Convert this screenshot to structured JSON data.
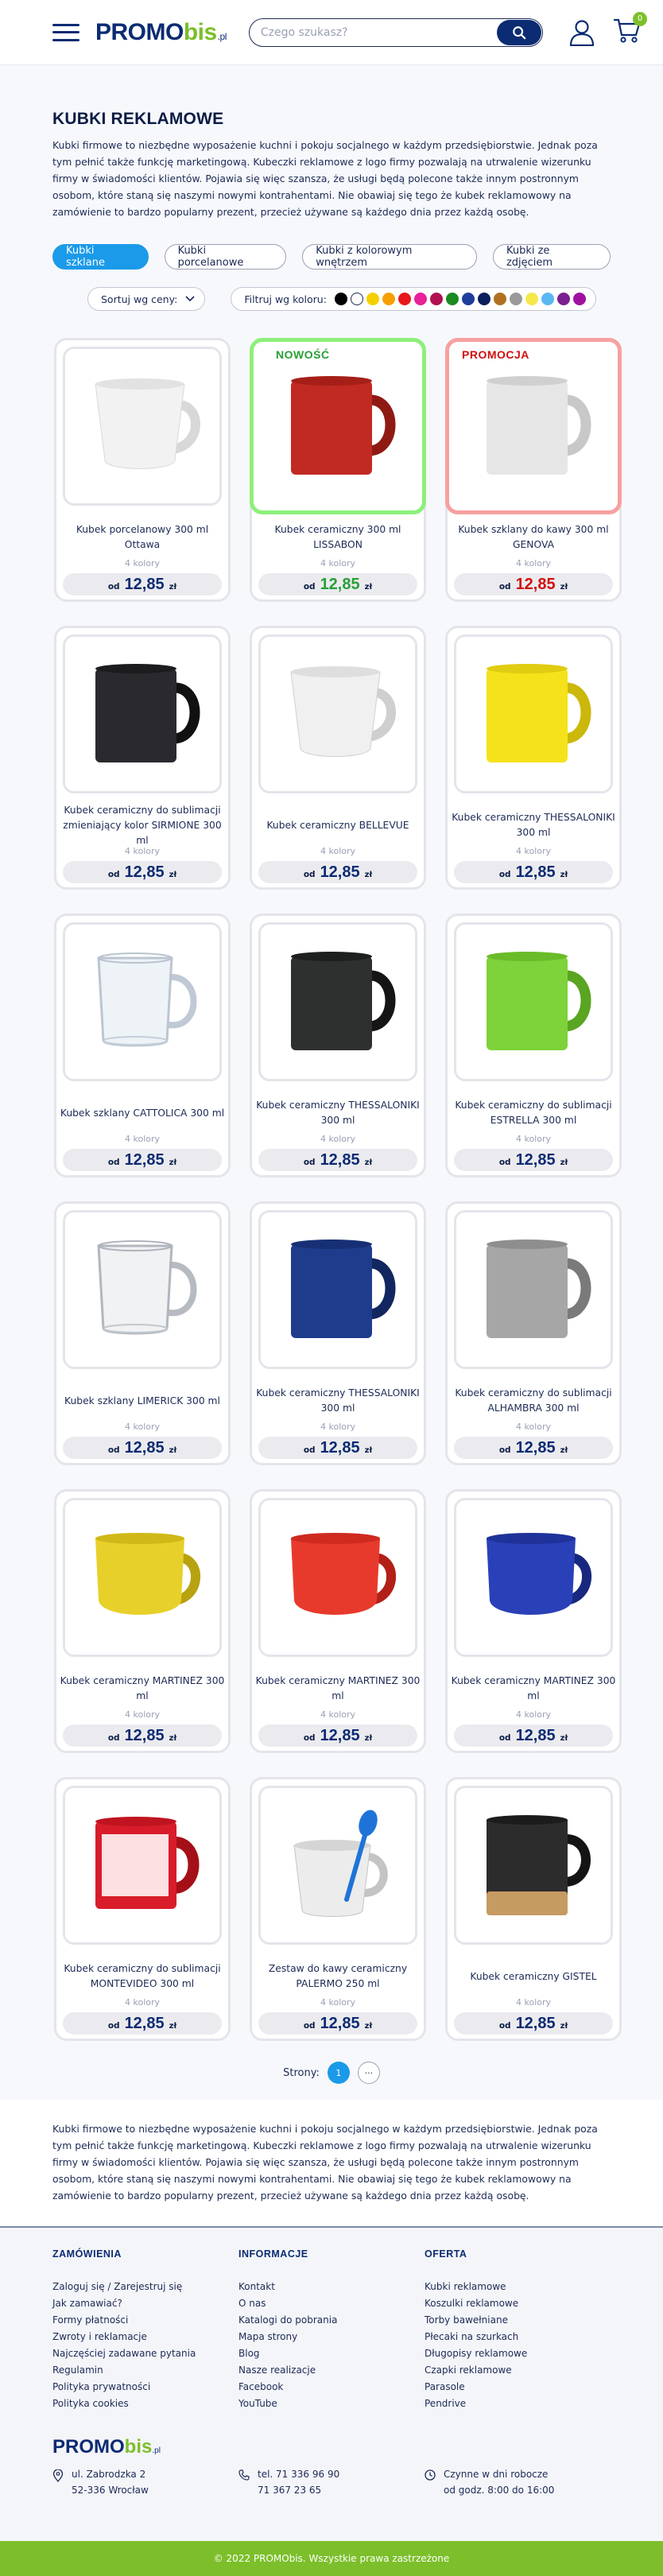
{
  "header": {
    "logo_main": "PROMO",
    "logo_accent": "bis",
    "logo_tld": ".pl",
    "search_placeholder": "Czego szukasz?",
    "cart_count": "0"
  },
  "page": {
    "title": "KUBKI REKLAMOWE",
    "intro": "Kubki firmowe to niezbędne wyposażenie kuchni i pokoju socjalnego w każdym przedsiębiorstwie. Jednak poza tym pełnić także funkcję marketingową. Kubeczki reklamowe z logo firmy pozwalają na utrwalenie wizerunku firmy w świadomości klientów. Pojawia się więc szansza, że usługi będą polecone także innym postronnym osobom, które staną się naszymi nowymi kontrahentami. Nie obawiaj się tego że kubek reklamowowy na zamówienie to bardzo popularny prezent, przecież używane są każdego dnia przez każdą osobę.",
    "outro": "Kubki firmowe to niezbędne wyposażenie kuchni i pokoju socjalnego w każdym przedsiębiorstwie. Jednak poza tym pełnić także funkcję marketingową. Kubeczki reklamowe z logo firmy pozwalają na utrwalenie wizerunku firmy w świadomości klientów. Pojawia się więc szansza, że usługi będą polecone także innym postronnym osobom, które staną się naszymi nowymi kontrahentami. Nie obawiaj się tego że kubek reklamowowy na zamówienie to bardzo popularny prezent, przecież używane są każdego dnia przez każdą osobę."
  },
  "tabs": [
    {
      "label": "Kubki szklane",
      "active": true
    },
    {
      "label": "Kubki porcelanowe",
      "active": false
    },
    {
      "label": "Kubki z kolorowym wnętrzem",
      "active": false
    },
    {
      "label": "Kubki ze zdjęciem",
      "active": false
    }
  ],
  "filters": {
    "sort_label": "Sortuj wg ceny:",
    "color_label": "Filtruj wg koloru:",
    "colors": [
      "#000000",
      "#ffffff",
      "#f5d000",
      "#f5a000",
      "#e81818",
      "#e8209a",
      "#b01050",
      "#1b8a20",
      "#1f3e9c",
      "#0a1f5c",
      "#b07020",
      "#9a9a9a",
      "#f5e84a",
      "#59b8f0",
      "#7a2090",
      "#a010a0"
    ]
  },
  "labels": {
    "od": "od",
    "currency": "zł",
    "new_badge": "NOWOŚĆ",
    "promo_badge": "PROMOCJA",
    "pages_label": "Strony:",
    "more_pages": "···"
  },
  "products": [
    {
      "name": "Kubek porcelanowy 300 ml Ottawa",
      "colors": "4 kolory",
      "price": "12,85",
      "badge": "",
      "mug": "white"
    },
    {
      "name": "Kubek ceramiczny 300 ml LISSABON",
      "colors": "4 kolory",
      "price": "12,85",
      "badge": "new",
      "mug": "red"
    },
    {
      "name": "Kubek szklany do kawy 300 ml GENOVA",
      "colors": "4 kolory",
      "price": "12,85",
      "badge": "promo",
      "mug": "frosted"
    },
    {
      "name": "Kubek ceramiczny do sublimacji zmieniający kolor SIRMIONE 300 ml",
      "colors": "4 kolory",
      "price": "12,85",
      "badge": "",
      "mug": "black-matte"
    },
    {
      "name": "Kubek ceramiczny BELLEVUE",
      "colors": "4 kolory",
      "price": "12,85",
      "badge": "",
      "mug": "white-flare"
    },
    {
      "name": "Kubek ceramiczny THESSALONIKI 300 ml",
      "colors": "4 kolory",
      "price": "12,85",
      "badge": "",
      "mug": "yellow"
    },
    {
      "name": "Kubek szklany CATTOLICA 300 ml",
      "colors": "4 kolory",
      "price": "12,85",
      "badge": "",
      "mug": "glass"
    },
    {
      "name": "Kubek ceramiczny THESSALONIKI 300 ml",
      "colors": "4 kolory",
      "price": "12,85",
      "badge": "",
      "mug": "dark"
    },
    {
      "name": "Kubek ceramiczny do sublimacji ESTRELLA 300 ml",
      "colors": "4 kolory",
      "price": "12,85",
      "badge": "",
      "mug": "green"
    },
    {
      "name": "Kubek szklany LIMERICK 300 ml",
      "colors": "4 kolory",
      "price": "12,85",
      "badge": "",
      "mug": "glass2"
    },
    {
      "name": "Kubek ceramiczny THESSALONIKI 300 ml",
      "colors": "4 kolory",
      "price": "12,85",
      "badge": "",
      "mug": "navy"
    },
    {
      "name": "Kubek ceramiczny do sublimacji ALHAMBRA 300 ml",
      "colors": "4 kolory",
      "price": "12,85",
      "badge": "",
      "mug": "silver"
    },
    {
      "name": "Kubek ceramiczny MARTINEZ 300 ml",
      "colors": "4 kolory",
      "price": "12,85",
      "badge": "",
      "mug": "yellow-round"
    },
    {
      "name": "Kubek ceramiczny MARTINEZ 300 ml",
      "colors": "4 kolory",
      "price": "12,85",
      "badge": "",
      "mug": "red-round"
    },
    {
      "name": "Kubek ceramiczny MARTINEZ 300 ml",
      "colors": "4 kolory",
      "price": "12,85",
      "badge": "",
      "mug": "blue-round"
    },
    {
      "name": "Kubek ceramiczny do sublimacji MONTEVIDEO 300 ml",
      "colors": "4 kolory",
      "price": "12,85",
      "badge": "",
      "mug": "red-window"
    },
    {
      "name": "Zestaw do kawy ceramiczny PALERMO 250 ml",
      "colors": "4 kolory",
      "price": "12,85",
      "badge": "",
      "mug": "spoon"
    },
    {
      "name": "Kubek ceramiczny GISTEL",
      "colors": "4 kolory",
      "price": "12,85",
      "badge": "",
      "mug": "cork"
    }
  ],
  "pagination": {
    "current": "1"
  },
  "footer": {
    "col1_title": "ZAMÓWIENIA",
    "col1_links": [
      "Zaloguj się / Zarejestruj się",
      "Jak zamawiać?",
      "Formy płatności",
      "Zwroty i reklamacje",
      "Najczęściej zadawane pytania",
      "Regulamin",
      "Polityka prywatności",
      "Polityka cookies"
    ],
    "col2_title": "INFORMACJE",
    "col2_links": [
      "Kontakt",
      "O nas",
      "Katalogi do pobrania",
      "Mapa strony",
      "Blog",
      "Nasze realizacje",
      "Facebook",
      "YouTube"
    ],
    "col3_title": "OFERTA",
    "col3_links": [
      "Kubki reklamowe",
      "Koszulki reklamowe",
      "Torby bawełniane",
      "Płecaki na szurkach",
      "Długopisy reklamowe",
      "Czapki reklamowe",
      "Parasole",
      "Pendrive"
    ],
    "address1": "ul. Zabrodzka 2",
    "address2": "52-336 Wrocław",
    "phone1": "tel. 71 336 96 90",
    "phone2": "71 367 23 65",
    "hours1": "Czynne w dni robocze",
    "hours2": "od godz. 8:00 do 16:00",
    "copyright": "© 2022 PROMObis. Wszystkie prawa zastrzeżone"
  }
}
